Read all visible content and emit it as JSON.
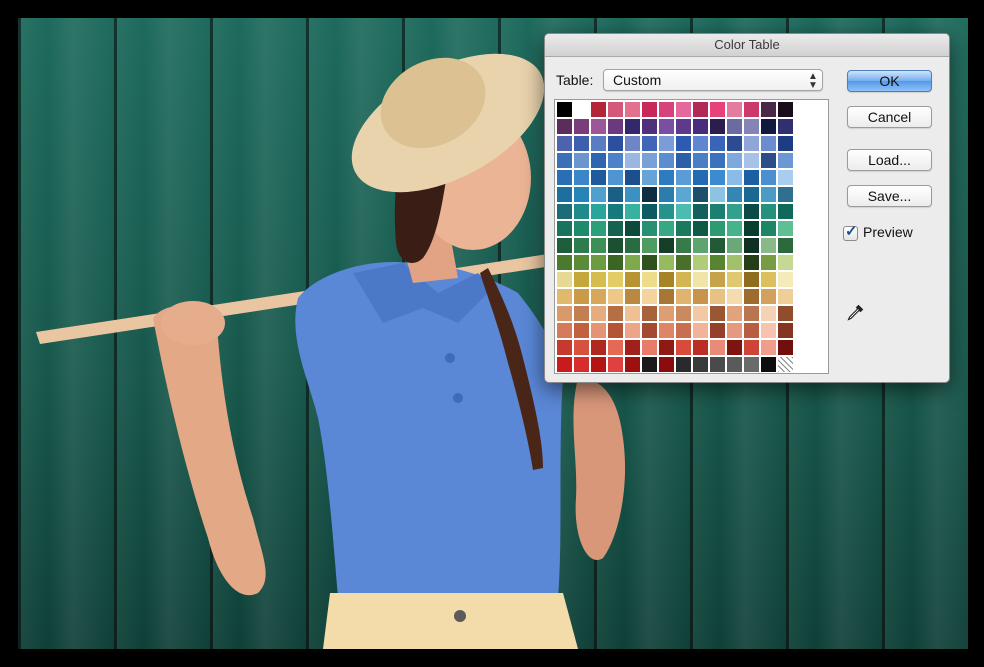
{
  "dialog": {
    "title": "Color Table",
    "table_label": "Table:",
    "table_value": "Custom",
    "buttons": {
      "ok": "OK",
      "cancel": "Cancel",
      "load": "Load...",
      "save": "Save..."
    },
    "preview_label": "Preview",
    "preview_checked": true,
    "icons": {
      "select_arrows": "up-down-chevron-icon",
      "eyedropper": "eyedropper-icon",
      "checkmark": "checkmark-icon"
    },
    "accent_color": "#5599ea",
    "swatch_rows": [
      [
        "#000000",
        "#ffffff",
        "#b3263a",
        "#d4587a",
        "#e3718d",
        "#c72759",
        "#d7427b",
        "#e5689d",
        "#b22a56",
        "#e5437a",
        "#e47ca1",
        "#cc3a6b",
        "#4b2847",
        "#1a0d19"
      ],
      [
        "#5c2d5a",
        "#7a3d7a",
        "#9c5796",
        "#6a3a7d",
        "#35286a",
        "#50307a",
        "#7a4ea3",
        "#5d3a8c",
        "#4a2d7a",
        "#2b1e4f",
        "#6b6ba1",
        "#8484b7",
        "#111a3d",
        "#303070"
      ],
      [
        "#4e63b0",
        "#3d5fae",
        "#5a7cc2",
        "#2d4fa0",
        "#6e86c5",
        "#4066b8",
        "#7d9bd6",
        "#2d5bb4",
        "#5e86d2",
        "#3a64b8",
        "#2b4c93",
        "#8fa6d6",
        "#6b8ccf",
        "#1c3d84"
      ],
      [
        "#3b6fb7",
        "#6a95cf",
        "#2e64b0",
        "#4d82c8",
        "#9bb6e0",
        "#7aa1d7",
        "#5c8dd0",
        "#2b5fa8",
        "#4b7fc5",
        "#3a72bd",
        "#7fa8dc",
        "#a8c2e6",
        "#2c4d86",
        "#6b97d4"
      ],
      [
        "#2a6fb5",
        "#3b86c9",
        "#1f5a9c",
        "#4e95d2",
        "#1b4f8d",
        "#66a4d8",
        "#2e7bc2",
        "#5b9bd7",
        "#226ab1",
        "#3c8bd0",
        "#89bce6",
        "#1d5fa3",
        "#4a8fcf",
        "#a9cdee"
      ],
      [
        "#1d6fa0",
        "#2685b8",
        "#4fa0cf",
        "#1b5e86",
        "#3b92c2",
        "#0f2d40",
        "#2d7cae",
        "#5aa7d3",
        "#1d4f6c",
        "#8cc2e2",
        "#3487b4",
        "#1a6993",
        "#4c9bc7",
        "#2f6f8f"
      ],
      [
        "#1b6b78",
        "#1f8a8a",
        "#2aa59a",
        "#167a7d",
        "#37b1a0",
        "#0e5a62",
        "#26928d",
        "#4cbcae",
        "#135f5c",
        "#1b7f72",
        "#32a08c",
        "#0c4a45",
        "#25917a",
        "#0f6a5b"
      ],
      [
        "#18745f",
        "#1e8a6c",
        "#2a9f7a",
        "#14624f",
        "#0d4a3b",
        "#279070",
        "#36a882",
        "#1b7a5e",
        "#0f5a44",
        "#2e9a72",
        "#46b48a",
        "#0a3f2f",
        "#1d8664",
        "#5fbf94"
      ],
      [
        "#1f5e3a",
        "#2e7c4b",
        "#3d8f56",
        "#1d4f33",
        "#2a6b3f",
        "#4f9c63",
        "#173f28",
        "#397a4a",
        "#5ea46e",
        "#235a36",
        "#6aa977",
        "#103021",
        "#8ab989",
        "#2c6a3e"
      ],
      [
        "#4a7a2c",
        "#5b8b36",
        "#6c9b41",
        "#3c6423",
        "#7dab4c",
        "#2f511c",
        "#94bb5e",
        "#496f2a",
        "#b0cb79",
        "#57842f",
        "#a3c06b",
        "#243f16",
        "#769d44",
        "#c5d894"
      ],
      [
        "#e8d896",
        "#c4a83c",
        "#d6bc4e",
        "#e3cc66",
        "#b89332",
        "#eddd8a",
        "#a78328",
        "#d3b653",
        "#f0e4a8",
        "#c6a34a",
        "#e0c871",
        "#8e6d1f",
        "#dcc060",
        "#f5eab9"
      ],
      [
        "#e0b96d",
        "#c99a48",
        "#d6a95a",
        "#edc887",
        "#b88940",
        "#f2d49c",
        "#a67735",
        "#dfb46e",
        "#c8934d",
        "#e8c285",
        "#f4dcae",
        "#9d6b2e",
        "#d2a160",
        "#efcf98"
      ],
      [
        "#d99a6b",
        "#c27f52",
        "#e5ac80",
        "#b46f45",
        "#efbf96",
        "#a7633c",
        "#dd9e73",
        "#c98a5f",
        "#f2c9a5",
        "#9b5634",
        "#e0a37b",
        "#b87550",
        "#f5d2b3",
        "#8f4d2c"
      ],
      [
        "#d67b5a",
        "#c1613f",
        "#e59375",
        "#b35437",
        "#ed a58a",
        "#a34a30",
        "#dd8565",
        "#c96f50",
        "#f1b39a",
        "#94402a",
        "#e59a80",
        "#b85c42",
        "#f6c3ae",
        "#853623"
      ],
      [
        "#c63a2e",
        "#d7513f",
        "#b0291f",
        "#e46a55",
        "#a12019",
        "#e97c68",
        "#8f1a14",
        "#d84a39",
        "#bb2e24",
        "#ea8b78",
        "#7d140f",
        "#cf4436",
        "#f09d8c",
        "#6f100c"
      ],
      [
        "#c91b1b",
        "#d62c2c",
        "#b51414",
        "#e04040",
        "#9e0f0f",
        "#1a1a1a",
        "#8a0c0c",
        "#2a2a2a",
        "#3a3a3a",
        "#4a4a4a",
        "#5a5a5a",
        "#6a6a6a",
        "#0d0d0d",
        "#ffffff"
      ]
    ]
  }
}
